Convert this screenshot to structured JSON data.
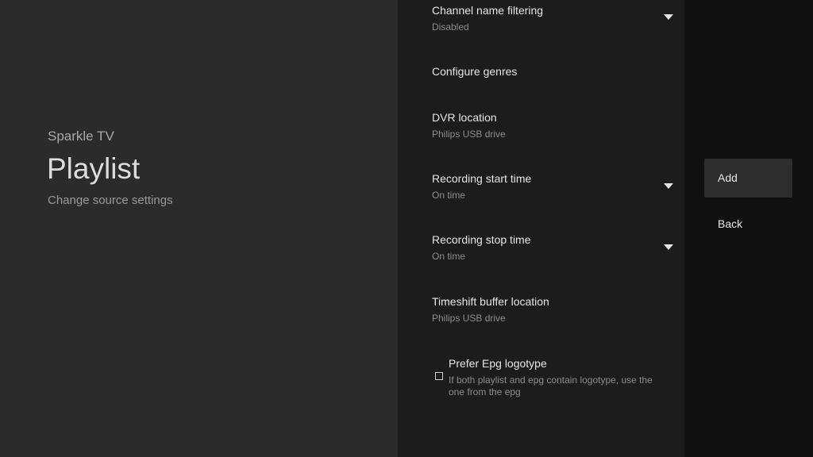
{
  "header": {
    "app_name": "Sparkle TV",
    "title": "Playlist",
    "subtitle": "Change source settings"
  },
  "settings": [
    {
      "title": "Channel name filtering",
      "value": "Disabled",
      "icon": "dropdown-arrow"
    },
    {
      "title": "Configure genres",
      "value": ""
    },
    {
      "title": "DVR location",
      "value": "Philips USB drive"
    },
    {
      "title": "Recording start time",
      "value": "On time",
      "icon": "dropdown-arrow"
    },
    {
      "title": "Recording stop time",
      "value": "On time",
      "icon": "dropdown-arrow"
    },
    {
      "title": "Timeshift buffer location",
      "value": "Philips USB drive"
    }
  ],
  "prefer_epg": {
    "title": "Prefer Epg logotype",
    "description": "If both playlist and epg contain logotype, use the one from the epg",
    "checked": false
  },
  "actions": {
    "add_label": "Add",
    "back_label": "Back"
  },
  "colors": {
    "left_pane": "#2b2b2b",
    "middle_pane": "#1c1c1c",
    "right_pane": "#111111",
    "focused_action": "#2d2d2d"
  }
}
